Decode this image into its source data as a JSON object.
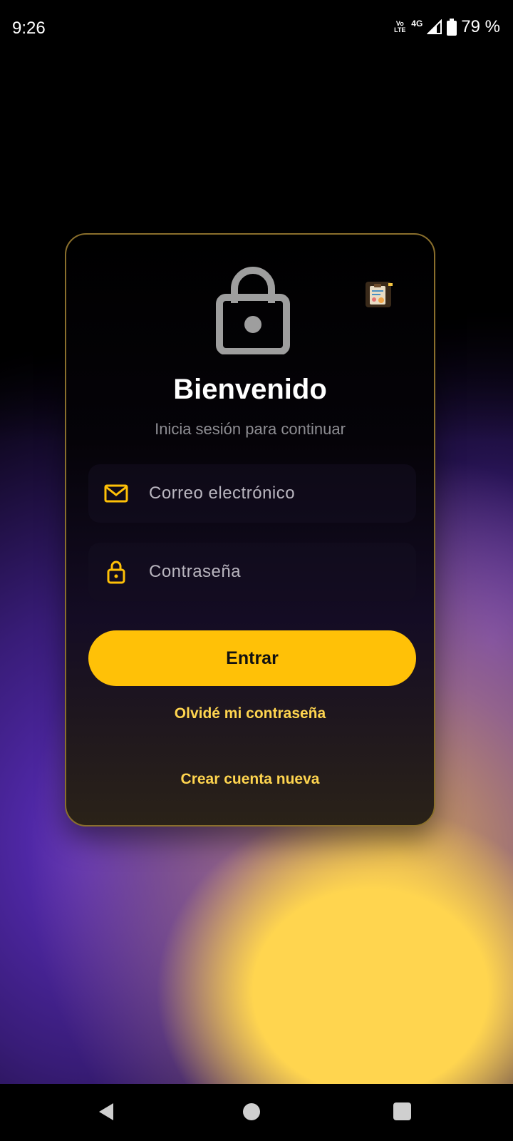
{
  "status_bar": {
    "time": "9:26",
    "volte_top": "Vo",
    "volte_bottom": "LTE",
    "network": "4G",
    "battery": "79 %"
  },
  "card": {
    "title": "Bienvenido",
    "subtitle": "Inicia sesión para continuar",
    "email_placeholder": "Correo electrónico",
    "password_placeholder": "Contraseña",
    "login_button": "Entrar",
    "forgot_link": "Olvidé mi contraseña",
    "create_link": "Crear cuenta nueva"
  },
  "icons": {
    "lock_main": "lock-icon",
    "sticker": "clipboard-sticker-icon",
    "email": "mail-icon",
    "password": "lock-icon"
  },
  "colors": {
    "accent": "#ffc107",
    "link": "#ffd54f",
    "card_border": "#8a6f2c",
    "lock_gray": "#9e9e9e"
  }
}
